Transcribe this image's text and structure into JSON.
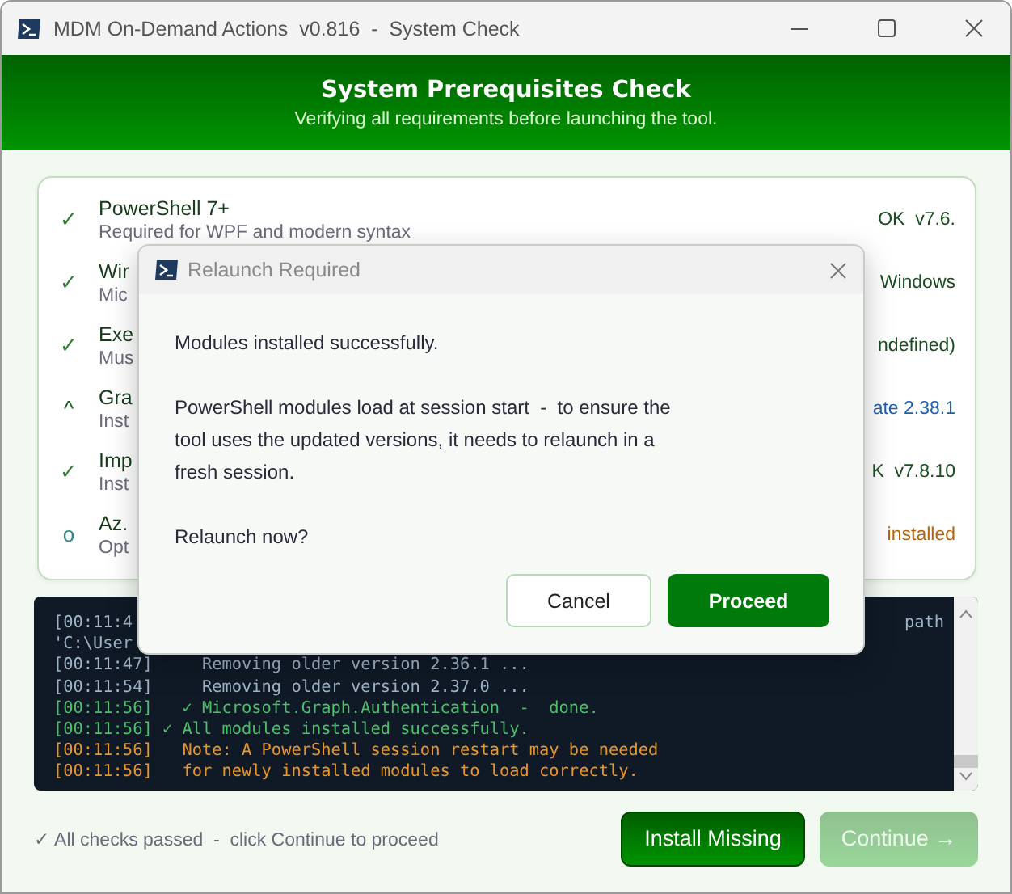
{
  "window": {
    "title": "MDM On-Demand Actions  v0.816  -  System Check"
  },
  "header": {
    "title": "System Prerequisites Check",
    "subtitle": "Verifying all requirements before launching the tool."
  },
  "checks": [
    {
      "icon": "✓",
      "kind": "ok",
      "name": "PowerShell 7+",
      "description": "Required for WPF and modern syntax",
      "status": "OK  v7.6."
    },
    {
      "icon": "✓",
      "kind": "ok",
      "name": "Wir",
      "description": "Mic",
      "status": "Windows"
    },
    {
      "icon": "✓",
      "kind": "ok",
      "name": "Exe",
      "description": "Mus",
      "status": "ndefined)"
    },
    {
      "icon": "^",
      "kind": "update",
      "name": "Gra",
      "description": "Inst",
      "status": "ate 2.38.1"
    },
    {
      "icon": "✓",
      "kind": "ok",
      "name": "Imp",
      "description": "Inst",
      "status": "K  v7.8.10"
    },
    {
      "icon": "o",
      "kind": "optional",
      "name": "Az.",
      "description": "Opt",
      "status": "installed"
    }
  ],
  "log": [
    {
      "kind": "split",
      "left": "[00:11:4",
      "right": "path",
      "color": "#9fb3c8"
    },
    {
      "kind": "line",
      "text": "'C:\\User",
      "color": "#9fb3c8"
    },
    {
      "kind": "line",
      "text": "[00:11:47]     Removing older version 2.36.1 ...",
      "color": "#9fb3c8"
    },
    {
      "kind": "line",
      "text": "[00:11:54]     Removing older version 2.37.0 ...",
      "color": "#9fb3c8"
    },
    {
      "kind": "line",
      "text": "[00:11:56]   ✓ Microsoft.Graph.Authentication  -  done.",
      "color": "#4cbf6a"
    },
    {
      "kind": "line",
      "text": "[00:11:56] ✓ All modules installed successfully.",
      "color": "#4cbf6a"
    },
    {
      "kind": "line",
      "text": "[00:11:56]   Note: A PowerShell session restart may be needed",
      "color": "#e8952a"
    },
    {
      "kind": "line",
      "text": "[00:11:56]   for newly installed modules to load correctly.",
      "color": "#e8952a"
    }
  ],
  "footer": {
    "status": "✓ All checks passed  -  click Continue to proceed",
    "buttons": [
      {
        "label": "Install Missing",
        "disabled": false
      },
      {
        "label": "Continue →",
        "disabled": true
      }
    ]
  },
  "dialog": {
    "title": "Relaunch Required",
    "paragraphs": [
      "Modules installed successfully.",
      "PowerShell modules load at session start  -  to ensure the tool uses the updated versions, it needs to relaunch in a fresh session.",
      "Relaunch now?"
    ],
    "buttons": [
      {
        "label": "Cancel",
        "kind": "secondary"
      },
      {
        "label": "Proceed",
        "kind": "primary"
      }
    ]
  }
}
